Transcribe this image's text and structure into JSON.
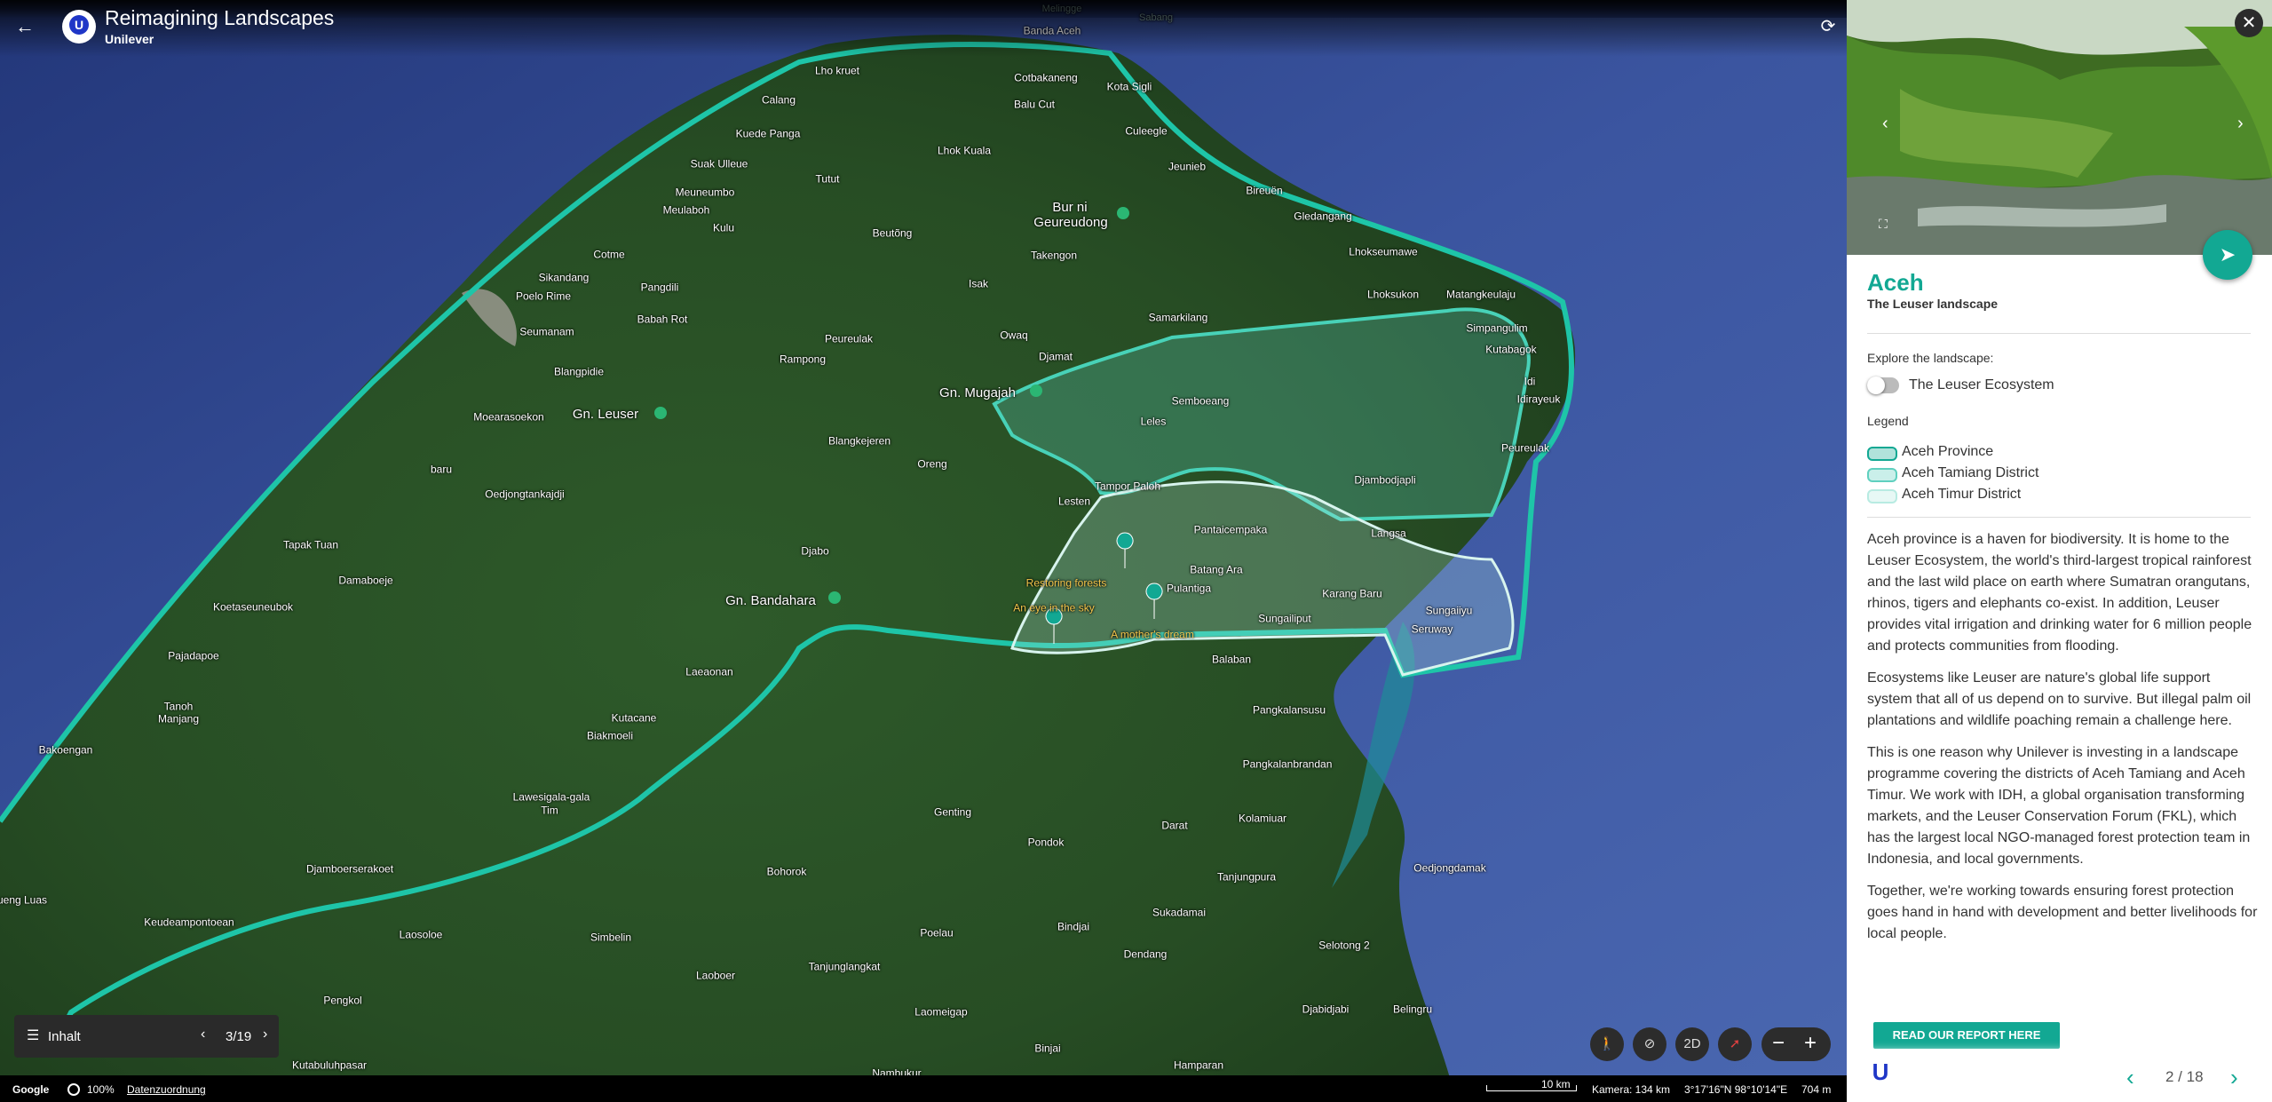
{
  "header": {
    "title": "Reimagining Landscapes",
    "subtitle": "Unilever"
  },
  "places": [
    {
      "name": "Banda Aceh",
      "kind": "normal"
    },
    {
      "name": "Melingge",
      "kind": "faint"
    },
    {
      "name": "Sabang",
      "kind": "faint"
    },
    {
      "name": "Lho kruet",
      "kind": "normal"
    },
    {
      "name": "Cotbakaneng",
      "kind": "normal"
    },
    {
      "name": "Kota Sigli",
      "kind": "normal"
    },
    {
      "name": "Calang",
      "kind": "normal"
    },
    {
      "name": "Balu Cut",
      "kind": "normal"
    },
    {
      "name": "Kuede Panga",
      "kind": "normal"
    },
    {
      "name": "Culeegle",
      "kind": "normal"
    },
    {
      "name": "Lhok Kuala",
      "kind": "normal"
    },
    {
      "name": "Suak Ulleue",
      "kind": "normal"
    },
    {
      "name": "Jeunieb",
      "kind": "normal"
    },
    {
      "name": "Tutut",
      "kind": "normal"
    },
    {
      "name": "Meuneumbo",
      "kind": "normal"
    },
    {
      "name": "Bireuën",
      "kind": "normal"
    },
    {
      "name": "Meulaboh",
      "kind": "normal"
    },
    {
      "name": "Bur ni",
      "kind": "big"
    },
    {
      "name": "Geureudong",
      "kind": "big"
    },
    {
      "name": "Gledangang",
      "kind": "normal"
    },
    {
      "name": "Kulu",
      "kind": "normal"
    },
    {
      "name": "Beutõng",
      "kind": "normal"
    },
    {
      "name": "Takengon",
      "kind": "normal"
    },
    {
      "name": "Cotme",
      "kind": "normal"
    },
    {
      "name": "Lhokseumawe",
      "kind": "normal"
    },
    {
      "name": "Sikandang",
      "kind": "normal"
    },
    {
      "name": "Pangdili",
      "kind": "normal"
    },
    {
      "name": "Isak",
      "kind": "normal"
    },
    {
      "name": "Lhoksukon",
      "kind": "normal"
    },
    {
      "name": "Matangkeulaju",
      "kind": "normal"
    },
    {
      "name": "Poelo Rime",
      "kind": "normal"
    },
    {
      "name": "Babah Rot",
      "kind": "normal"
    },
    {
      "name": "Samarkilang",
      "kind": "normal"
    },
    {
      "name": "Simpangulim",
      "kind": "normal"
    },
    {
      "name": "Seumanam",
      "kind": "normal"
    },
    {
      "name": "Peureulak",
      "kind": "normal"
    },
    {
      "name": "Owaq",
      "kind": "normal"
    },
    {
      "name": "Kutabagok",
      "kind": "normal"
    },
    {
      "name": "Rampong",
      "kind": "normal"
    },
    {
      "name": "Djamat",
      "kind": "normal"
    },
    {
      "name": "Blangpidie",
      "kind": "normal"
    },
    {
      "name": "Idi",
      "kind": "normal"
    },
    {
      "name": "Gn. Mugajah",
      "kind": "big"
    },
    {
      "name": "Idirayeuk",
      "kind": "normal"
    },
    {
      "name": "Semboeang",
      "kind": "normal"
    },
    {
      "name": "Gn. Leuser",
      "kind": "big"
    },
    {
      "name": "Moearasoekon",
      "kind": "normal"
    },
    {
      "name": "Leles",
      "kind": "normal"
    },
    {
      "name": "Blangkejeren",
      "kind": "normal"
    },
    {
      "name": "Peureulak",
      "kind": "normal"
    },
    {
      "name": "Oreng",
      "kind": "normal"
    },
    {
      "name": "baru",
      "kind": "normal"
    },
    {
      "name": "Tampor Paloh",
      "kind": "normal"
    },
    {
      "name": "Djambodjapli",
      "kind": "normal"
    },
    {
      "name": "Oedjongtankajdji",
      "kind": "normal"
    },
    {
      "name": "Lesten",
      "kind": "normal"
    },
    {
      "name": "Pantaicempaka",
      "kind": "normal"
    },
    {
      "name": "Langsa",
      "kind": "normal"
    },
    {
      "name": "Tapak Tuan",
      "kind": "normal"
    },
    {
      "name": "Djabo",
      "kind": "normal"
    },
    {
      "name": "Damaboeje",
      "kind": "normal"
    },
    {
      "name": "Batang Ara",
      "kind": "normal"
    },
    {
      "name": "Restoring forests",
      "kind": "story"
    },
    {
      "name": "Pulantiga",
      "kind": "normal"
    },
    {
      "name": "Karang Baru",
      "kind": "normal"
    },
    {
      "name": "Koetaseuneubok",
      "kind": "normal"
    },
    {
      "name": "Gn. Bandahara",
      "kind": "big"
    },
    {
      "name": "An eye in the sky",
      "kind": "story"
    },
    {
      "name": "Sungaiiyu",
      "kind": "normal"
    },
    {
      "name": "Sungailiput",
      "kind": "normal"
    },
    {
      "name": "Seruway",
      "kind": "normal"
    },
    {
      "name": "A mother's dream",
      "kind": "story"
    },
    {
      "name": "Pajadapoe",
      "kind": "normal"
    },
    {
      "name": "Balaban",
      "kind": "normal"
    },
    {
      "name": "Laeaonan",
      "kind": "normal"
    },
    {
      "name": "Tanoh",
      "kind": "normal"
    },
    {
      "name": "Manjang",
      "kind": "normal"
    },
    {
      "name": "Pangkalansusu",
      "kind": "normal"
    },
    {
      "name": "Kutacane",
      "kind": "normal"
    },
    {
      "name": "Biakmoeli",
      "kind": "normal"
    },
    {
      "name": "Bakoengan",
      "kind": "normal"
    },
    {
      "name": "Pangkalanbrandan",
      "kind": "normal"
    },
    {
      "name": "Lawesigala-gala",
      "kind": "normal"
    },
    {
      "name": "Tim",
      "kind": "normal"
    },
    {
      "name": "Genting",
      "kind": "normal"
    },
    {
      "name": "Darat",
      "kind": "normal"
    },
    {
      "name": "Kolamiuar",
      "kind": "normal"
    },
    {
      "name": "Pondok",
      "kind": "normal"
    },
    {
      "name": "Oedjongdamak",
      "kind": "normal"
    },
    {
      "name": "Djamboerserakoet",
      "kind": "normal"
    },
    {
      "name": "Bohorok",
      "kind": "normal"
    },
    {
      "name": "Tanjungpura",
      "kind": "normal"
    },
    {
      "name": "rueng Luas",
      "kind": "normal"
    },
    {
      "name": "Keudeampontoean",
      "kind": "normal"
    },
    {
      "name": "Sukadamai",
      "kind": "normal"
    },
    {
      "name": "Laosoloe",
      "kind": "normal"
    },
    {
      "name": "Poelau",
      "kind": "normal"
    },
    {
      "name": "Bindjai",
      "kind": "normal"
    },
    {
      "name": "Simbelin",
      "kind": "normal"
    },
    {
      "name": "Selotong 2",
      "kind": "normal"
    },
    {
      "name": "Dendang",
      "kind": "normal"
    },
    {
      "name": "Tanjunglangkat",
      "kind": "normal"
    },
    {
      "name": "Laoboer",
      "kind": "normal"
    },
    {
      "name": "Pengkol",
      "kind": "normal"
    },
    {
      "name": "Djabidjabi",
      "kind": "normal"
    },
    {
      "name": "Belingru",
      "kind": "normal"
    },
    {
      "name": "Laomeigap",
      "kind": "normal"
    },
    {
      "name": "Binjai",
      "kind": "normal"
    },
    {
      "name": "Kutabuluhpasar",
      "kind": "normal"
    },
    {
      "name": "Hamparan",
      "kind": "normal"
    },
    {
      "name": "Nambukur",
      "kind": "normal"
    }
  ],
  "tour": {
    "label": "Inhalt",
    "counter": "3/19"
  },
  "controls": {
    "mode_2d": "2D"
  },
  "footer": {
    "google": "Google",
    "percent": "100%",
    "attribution": "Datenzuordnung",
    "scale": "10 km",
    "camera": "Kamera: 134 km",
    "coords": "3°17'16\"N 98°10'14\"E",
    "elevation": "704 m"
  },
  "panel": {
    "title": "Aceh",
    "subtitle": "The Leuser landscape",
    "explore_label": "Explore the landscape:",
    "toggle_label": "The Leuser Ecosystem",
    "toggle_on": false,
    "legend_label": "Legend",
    "legend": [
      {
        "label": "Aceh Province",
        "color": "#12a893"
      },
      {
        "label": "Aceh Tamiang District",
        "color": "#5fd0bf"
      },
      {
        "label": "Aceh Timur District",
        "color": "#b8ebe2"
      }
    ],
    "paragraphs": [
      "Aceh province is a haven for biodiversity. It is home to the Leuser Ecosystem, the world's third-largest tropical rainforest and the last wild place on earth where Sumatran orangutans, rhinos, tigers and elephants co-exist. In addition, Leuser provides vital irrigation and drinking water for 6 million people and protects communities from flooding.",
      "Ecosystems like Leuser are nature's global life support system that all of us depend on to survive. But illegal palm oil plantations and wildlife poaching remain a challenge here.",
      "This is one reason why Unilever is investing in a landscape programme covering the districts of Aceh Tamiang and Aceh Timur. We work with IDH, a global organisation transforming markets, and the Leuser Conservation Forum (FKL), which has the largest local NGO-managed forest protection team in Indonesia, and local governments.",
      "Together, we're working towards ensuring forest protection goes hand in hand with development and better livelihoods for local people."
    ],
    "cta": "READ OUR REPORT HERE",
    "pager": "2 / 18"
  },
  "colors": {
    "accent": "#12a893",
    "ocean": "#3c5a9a",
    "land": "#2f5a2c"
  }
}
